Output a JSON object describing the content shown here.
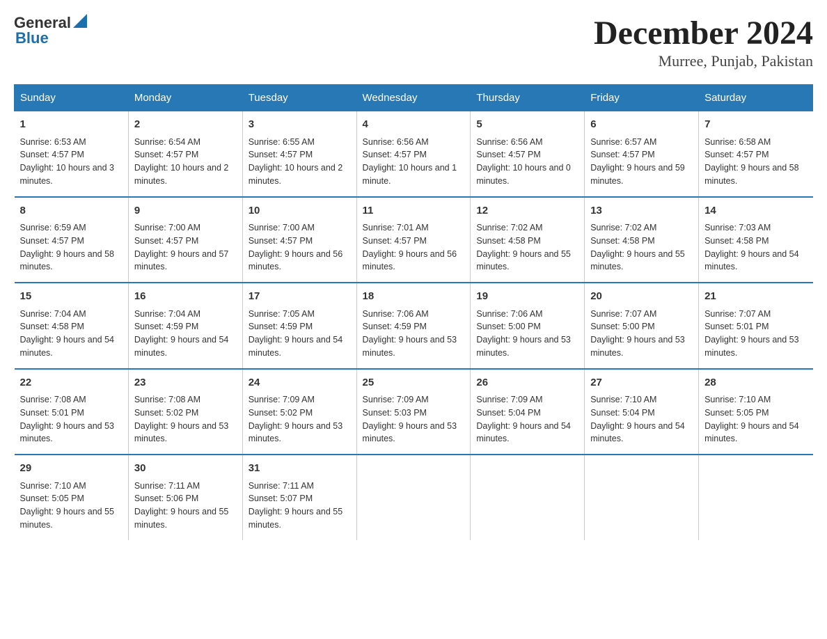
{
  "header": {
    "logo_general": "General",
    "logo_blue": "Blue",
    "month_title": "December 2024",
    "location": "Murree, Punjab, Pakistan"
  },
  "days_of_week": [
    "Sunday",
    "Monday",
    "Tuesday",
    "Wednesday",
    "Thursday",
    "Friday",
    "Saturday"
  ],
  "weeks": [
    [
      {
        "day": "1",
        "sunrise": "6:53 AM",
        "sunset": "4:57 PM",
        "daylight": "10 hours and 3 minutes."
      },
      {
        "day": "2",
        "sunrise": "6:54 AM",
        "sunset": "4:57 PM",
        "daylight": "10 hours and 2 minutes."
      },
      {
        "day": "3",
        "sunrise": "6:55 AM",
        "sunset": "4:57 PM",
        "daylight": "10 hours and 2 minutes."
      },
      {
        "day": "4",
        "sunrise": "6:56 AM",
        "sunset": "4:57 PM",
        "daylight": "10 hours and 1 minute."
      },
      {
        "day": "5",
        "sunrise": "6:56 AM",
        "sunset": "4:57 PM",
        "daylight": "10 hours and 0 minutes."
      },
      {
        "day": "6",
        "sunrise": "6:57 AM",
        "sunset": "4:57 PM",
        "daylight": "9 hours and 59 minutes."
      },
      {
        "day": "7",
        "sunrise": "6:58 AM",
        "sunset": "4:57 PM",
        "daylight": "9 hours and 58 minutes."
      }
    ],
    [
      {
        "day": "8",
        "sunrise": "6:59 AM",
        "sunset": "4:57 PM",
        "daylight": "9 hours and 58 minutes."
      },
      {
        "day": "9",
        "sunrise": "7:00 AM",
        "sunset": "4:57 PM",
        "daylight": "9 hours and 57 minutes."
      },
      {
        "day": "10",
        "sunrise": "7:00 AM",
        "sunset": "4:57 PM",
        "daylight": "9 hours and 56 minutes."
      },
      {
        "day": "11",
        "sunrise": "7:01 AM",
        "sunset": "4:57 PM",
        "daylight": "9 hours and 56 minutes."
      },
      {
        "day": "12",
        "sunrise": "7:02 AM",
        "sunset": "4:58 PM",
        "daylight": "9 hours and 55 minutes."
      },
      {
        "day": "13",
        "sunrise": "7:02 AM",
        "sunset": "4:58 PM",
        "daylight": "9 hours and 55 minutes."
      },
      {
        "day": "14",
        "sunrise": "7:03 AM",
        "sunset": "4:58 PM",
        "daylight": "9 hours and 54 minutes."
      }
    ],
    [
      {
        "day": "15",
        "sunrise": "7:04 AM",
        "sunset": "4:58 PM",
        "daylight": "9 hours and 54 minutes."
      },
      {
        "day": "16",
        "sunrise": "7:04 AM",
        "sunset": "4:59 PM",
        "daylight": "9 hours and 54 minutes."
      },
      {
        "day": "17",
        "sunrise": "7:05 AM",
        "sunset": "4:59 PM",
        "daylight": "9 hours and 54 minutes."
      },
      {
        "day": "18",
        "sunrise": "7:06 AM",
        "sunset": "4:59 PM",
        "daylight": "9 hours and 53 minutes."
      },
      {
        "day": "19",
        "sunrise": "7:06 AM",
        "sunset": "5:00 PM",
        "daylight": "9 hours and 53 minutes."
      },
      {
        "day": "20",
        "sunrise": "7:07 AM",
        "sunset": "5:00 PM",
        "daylight": "9 hours and 53 minutes."
      },
      {
        "day": "21",
        "sunrise": "7:07 AM",
        "sunset": "5:01 PM",
        "daylight": "9 hours and 53 minutes."
      }
    ],
    [
      {
        "day": "22",
        "sunrise": "7:08 AM",
        "sunset": "5:01 PM",
        "daylight": "9 hours and 53 minutes."
      },
      {
        "day": "23",
        "sunrise": "7:08 AM",
        "sunset": "5:02 PM",
        "daylight": "9 hours and 53 minutes."
      },
      {
        "day": "24",
        "sunrise": "7:09 AM",
        "sunset": "5:02 PM",
        "daylight": "9 hours and 53 minutes."
      },
      {
        "day": "25",
        "sunrise": "7:09 AM",
        "sunset": "5:03 PM",
        "daylight": "9 hours and 53 minutes."
      },
      {
        "day": "26",
        "sunrise": "7:09 AM",
        "sunset": "5:04 PM",
        "daylight": "9 hours and 54 minutes."
      },
      {
        "day": "27",
        "sunrise": "7:10 AM",
        "sunset": "5:04 PM",
        "daylight": "9 hours and 54 minutes."
      },
      {
        "day": "28",
        "sunrise": "7:10 AM",
        "sunset": "5:05 PM",
        "daylight": "9 hours and 54 minutes."
      }
    ],
    [
      {
        "day": "29",
        "sunrise": "7:10 AM",
        "sunset": "5:05 PM",
        "daylight": "9 hours and 55 minutes."
      },
      {
        "day": "30",
        "sunrise": "7:11 AM",
        "sunset": "5:06 PM",
        "daylight": "9 hours and 55 minutes."
      },
      {
        "day": "31",
        "sunrise": "7:11 AM",
        "sunset": "5:07 PM",
        "daylight": "9 hours and 55 minutes."
      },
      {
        "day": "",
        "sunrise": "",
        "sunset": "",
        "daylight": ""
      },
      {
        "day": "",
        "sunrise": "",
        "sunset": "",
        "daylight": ""
      },
      {
        "day": "",
        "sunrise": "",
        "sunset": "",
        "daylight": ""
      },
      {
        "day": "",
        "sunrise": "",
        "sunset": "",
        "daylight": ""
      }
    ]
  ]
}
